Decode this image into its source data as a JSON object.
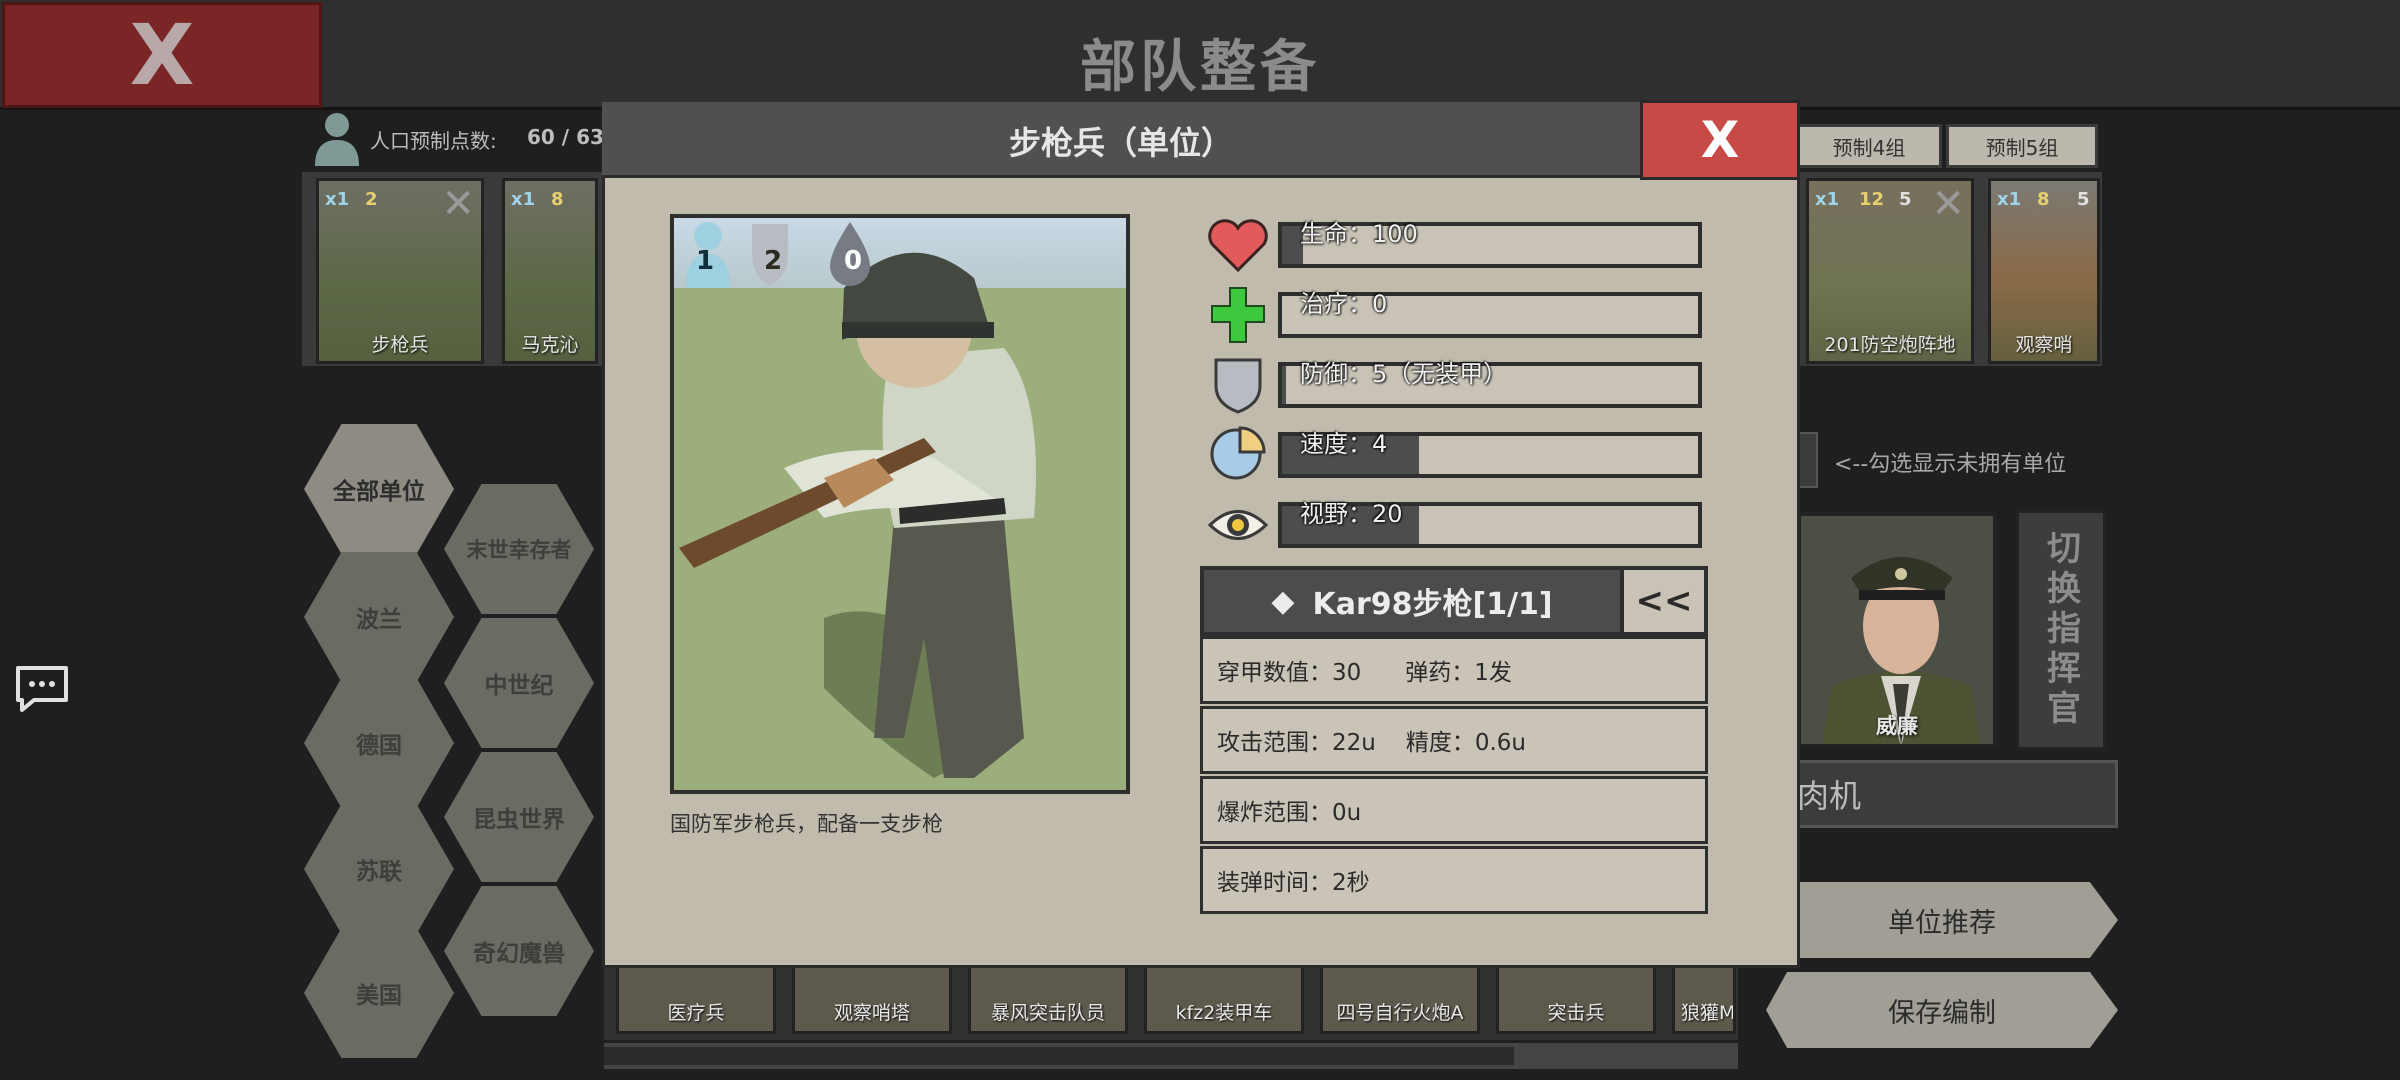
{
  "topbar": {
    "exit_label": "X",
    "title": "部队整备"
  },
  "population": {
    "label": "人口预制点数:",
    "value": "60 / 63"
  },
  "presets": [
    "预制4组",
    "预制5组"
  ],
  "unit_slots": [
    {
      "label": "步枪兵",
      "badge_count": "x1",
      "badge_cost": "2"
    },
    {
      "label": "马克沁",
      "badge_count": "x1",
      "badge_cost": "8"
    },
    {
      "label": "201防空炮阵地",
      "badge_count": "x1",
      "badge_cost": "12",
      "badge_armor": "5"
    },
    {
      "label": "观察哨",
      "badge_count": "x1",
      "badge_cost": "8",
      "badge_armor": "5"
    }
  ],
  "factions": [
    "全部单位",
    "末世幸存者",
    "波兰",
    "中世纪",
    "德国",
    "昆虫世界",
    "苏联",
    "奇幻魔兽",
    "美国"
  ],
  "bottom_units": [
    "医疗兵",
    "观察哨塔",
    "暴风突击队员",
    "kfz2装甲车",
    "四号自行火炮A",
    "突击兵",
    "狼獾M"
  ],
  "side": {
    "show_unowned_label": "<--勾选显示未拥有单位",
    "commander_name": "威廉",
    "switch_label": "切换指挥官",
    "deck_name": "肉机",
    "recommend_label": "单位推荐",
    "save_label": "保存编制"
  },
  "modal": {
    "title": "步枪兵（单位）",
    "close_label": "X",
    "portrait_badges": {
      "population": "1",
      "cost": "2",
      "armor": "0"
    },
    "description": "国防军步枪兵，配备一支步枪",
    "stats": [
      {
        "icon": "heart-icon",
        "label": "生命：100",
        "fill": 0.05
      },
      {
        "icon": "heal-icon",
        "label": "治疗：0",
        "fill": 0.0
      },
      {
        "icon": "shield-icon",
        "label": "防御：5（无装甲）",
        "fill": 0.01
      },
      {
        "icon": "speed-icon",
        "label": "速度：4",
        "fill": 0.33
      },
      {
        "icon": "eye-icon",
        "label": "视野：20",
        "fill": 0.33
      }
    ],
    "weapon": {
      "name": "Kar98步枪[1/1]",
      "toggle_label": "<<",
      "armor_pen": "穿甲数值：30",
      "ammo": "弹药：1发",
      "range": "攻击范围：22u",
      "accuracy": "精度：0.6u",
      "blast": "爆炸范围：0u",
      "reload": "装弹时间：2秒"
    }
  },
  "colors": {
    "close_red": "#c84a46",
    "exit_red": "#7a2626",
    "panel_beige": "#c0bbad"
  }
}
